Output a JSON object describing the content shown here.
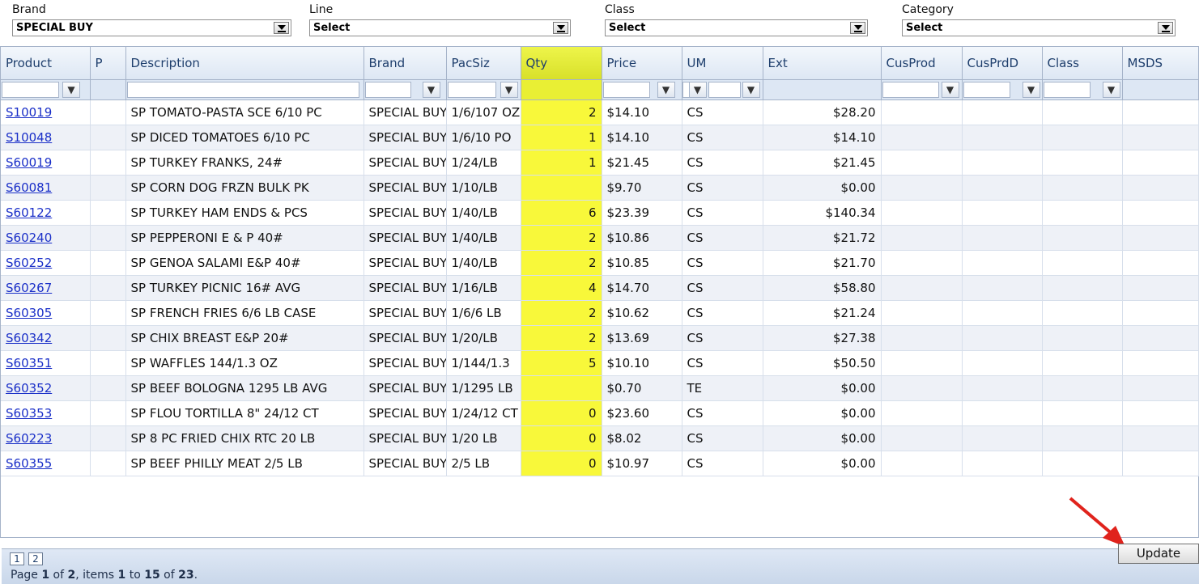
{
  "filters": [
    {
      "label": "Brand",
      "value": "SPECIAL BUY"
    },
    {
      "label": "Line",
      "value": "Select"
    },
    {
      "label": "Class",
      "value": "Select"
    },
    {
      "label": "Category",
      "value": "Select"
    }
  ],
  "grid": {
    "columns": [
      "Product",
      "P",
      "Description",
      "Brand",
      "PacSiz",
      "Qty",
      "Price",
      "UM",
      "Ext",
      "CusProd",
      "CusPrdD",
      "Class",
      "MSDS"
    ],
    "rows": [
      {
        "product": "S10019",
        "description": "SP TOMATO-PASTA SCE 6/10 PC",
        "brand": "SPECIAL BUY",
        "pacsiz": "1/6/107 OZ",
        "qty": "2",
        "price": "$14.10",
        "um": "CS",
        "ext": "$28.20"
      },
      {
        "product": "S10048",
        "description": "SP DICED TOMATOES 6/10 PC",
        "brand": "SPECIAL BUY",
        "pacsiz": "1/6/10 PO",
        "qty": "1",
        "price": "$14.10",
        "um": "CS",
        "ext": "$14.10"
      },
      {
        "product": "S60019",
        "description": "SP TURKEY FRANKS, 24#",
        "brand": "SPECIAL BUY",
        "pacsiz": "1/24/LB",
        "qty": "1",
        "price": "$21.45",
        "um": "CS",
        "ext": "$21.45"
      },
      {
        "product": "S60081",
        "description": "SP CORN DOG FRZN BULK PK",
        "brand": "SPECIAL BUY",
        "pacsiz": "1/10/LB",
        "qty": "",
        "price": "$9.70",
        "um": "CS",
        "ext": "$0.00"
      },
      {
        "product": "S60122",
        "description": "SP TURKEY HAM ENDS & PCS",
        "brand": "SPECIAL BUY",
        "pacsiz": "1/40/LB",
        "qty": "6",
        "price": "$23.39",
        "um": "CS",
        "ext": "$140.34"
      },
      {
        "product": "S60240",
        "description": "SP PEPPERONI E & P 40#",
        "brand": "SPECIAL BUY",
        "pacsiz": "1/40/LB",
        "qty": "2",
        "price": "$10.86",
        "um": "CS",
        "ext": "$21.72"
      },
      {
        "product": "S60252",
        "description": "SP GENOA SALAMI E&P 40#",
        "brand": "SPECIAL BUY",
        "pacsiz": "1/40/LB",
        "qty": "2",
        "price": "$10.85",
        "um": "CS",
        "ext": "$21.70"
      },
      {
        "product": "S60267",
        "description": "SP TURKEY PICNIC 16# AVG",
        "brand": "SPECIAL BUY",
        "pacsiz": "1/16/LB",
        "qty": "4",
        "price": "$14.70",
        "um": "CS",
        "ext": "$58.80"
      },
      {
        "product": "S60305",
        "description": "SP FRENCH FRIES 6/6 LB CASE",
        "brand": "SPECIAL BUY",
        "pacsiz": "1/6/6 LB",
        "qty": "2",
        "price": "$10.62",
        "um": "CS",
        "ext": "$21.24"
      },
      {
        "product": "S60342",
        "description": "SP CHIX BREAST E&P 20#",
        "brand": "SPECIAL BUY",
        "pacsiz": "1/20/LB",
        "qty": "2",
        "price": "$13.69",
        "um": "CS",
        "ext": "$27.38"
      },
      {
        "product": "S60351",
        "description": "SP WAFFLES 144/1.3 OZ",
        "brand": "SPECIAL BUY",
        "pacsiz": "1/144/1.3",
        "qty": "5",
        "price": "$10.10",
        "um": "CS",
        "ext": "$50.50"
      },
      {
        "product": "S60352",
        "description": "SP BEEF BOLOGNA 1295 LB AVG",
        "brand": "SPECIAL BUY",
        "pacsiz": "1/1295 LB",
        "qty": "",
        "price": "$0.70",
        "um": "TE",
        "ext": "$0.00"
      },
      {
        "product": "S60353",
        "description": "SP FLOU TORTILLA 8\" 24/12 CT",
        "brand": "SPECIAL BUY",
        "pacsiz": "1/24/12 CT",
        "qty": "0",
        "price": "$23.60",
        "um": "CS",
        "ext": "$0.00"
      },
      {
        "product": "S60223",
        "description": "SP 8 PC FRIED CHIX RTC 20 LB",
        "brand": "SPECIAL BUY",
        "pacsiz": "1/20 LB",
        "qty": "0",
        "price": "$8.02",
        "um": "CS",
        "ext": "$0.00"
      },
      {
        "product": "S60355",
        "description": "SP BEEF PHILLY MEAT 2/5 LB",
        "brand": "SPECIAL BUY",
        "pacsiz": "2/5 LB",
        "qty": "0",
        "price": "$10.97",
        "um": "CS",
        "ext": "$0.00"
      }
    ]
  },
  "pager": {
    "pages": [
      "1",
      "2"
    ],
    "info_prefix": "Page ",
    "page": "1",
    "of_text": " of ",
    "total_pages": "2",
    "items_text": ", items ",
    "from": "1",
    "to_text": " to ",
    "to": "15",
    "of2_text": " of ",
    "total": "23",
    "end": "."
  },
  "actions": {
    "update_label": "Update"
  },
  "colors": {
    "highlight": "#f8f83a",
    "arrow": "#e0231c",
    "link": "#1a2fc8"
  }
}
